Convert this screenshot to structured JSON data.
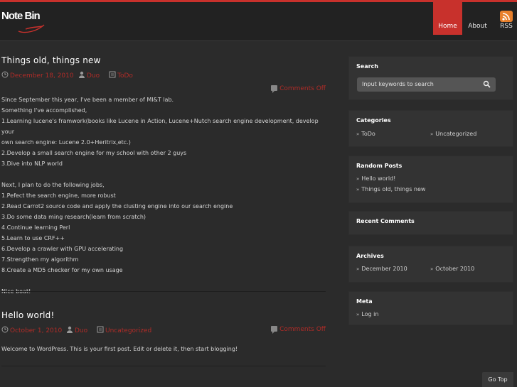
{
  "site": {
    "logo_text": "Note Bin"
  },
  "nav": [
    {
      "label": "Home"
    },
    {
      "label": "About"
    },
    {
      "label": "RSS"
    }
  ],
  "posts": [
    {
      "title": "Things old, things new",
      "date": "December 18, 2010",
      "author": "Duo",
      "category": "ToDo",
      "comments": "Comments Off",
      "body": [
        "Since September this year, I've been a member of MI&T lab.",
        "Something I've accomplished,",
        "1.Learning lucene's framwork(books like Lucene in Action, Lucene+Nutch search engine development, develop your",
        "own search engine: Lucene 2.0+Heritrix,etc.)",
        "2.Develop a small search engine for my school with other 2 guys",
        "3.Dive into NLP world",
        "",
        "Next, I plan to do the following jobs,",
        "1.Pefect the search engine, more robust",
        "2.Read Carrot2 source code and apply the clusting engine into our search engine",
        "3.Do some data ming research(learn from scratch)",
        "4.Continue learning Perl",
        "5.Learn to use CRF++",
        "6.Develop a crawler with GPU accelerating",
        "7.Strengthen my algorithm",
        "8.Create a MD5 checker for my own usage",
        "",
        "Nice boat!"
      ]
    },
    {
      "title": "Hello world!",
      "date": "October 1, 2010",
      "author": "Duo",
      "category": "Uncategorized",
      "comments": "Comments Off",
      "body": [
        "Welcome to WordPress. This is your first post. Edit or delete it, then start blogging!"
      ]
    }
  ],
  "sidebar": {
    "search": {
      "title": "Search",
      "placeholder": "Input keywords to search"
    },
    "categories": {
      "title": "Categories",
      "items": [
        "ToDo",
        "Uncategorized"
      ]
    },
    "random_posts": {
      "title": "Random Posts",
      "items": [
        "Hello world!",
        "Things old, things new"
      ]
    },
    "recent_comments": {
      "title": "Recent Comments"
    },
    "archives": {
      "title": "Archives",
      "items": [
        "December 2010",
        "October 2010"
      ]
    },
    "meta": {
      "title": "Meta",
      "items": [
        "Log in"
      ]
    }
  },
  "go_top": "Go Top",
  "colors": {
    "accent": "#c8312c",
    "background": "#2b2b2b",
    "widget": "#333333",
    "rss": "#e8802c"
  }
}
